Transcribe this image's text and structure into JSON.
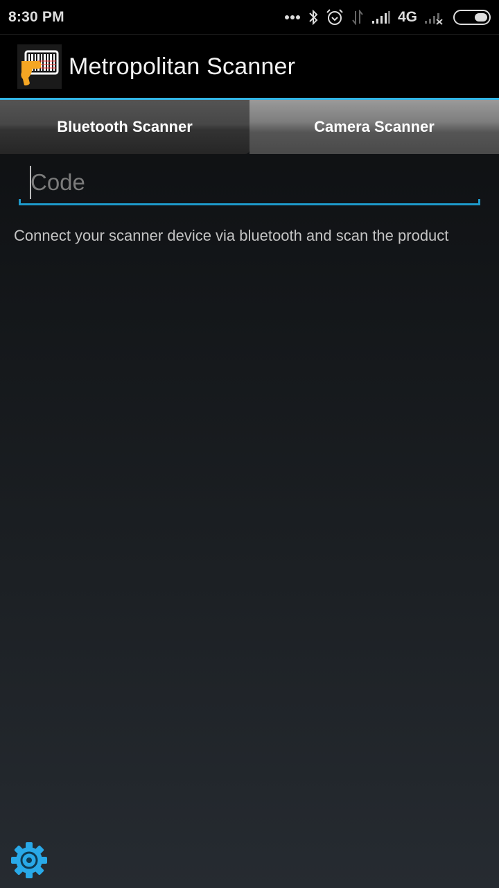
{
  "status_bar": {
    "time": "8:30 PM",
    "icons": [
      "more-dots-icon",
      "bluetooth-icon",
      "alarm-icon",
      "data-transfer-icon",
      "signal-icon",
      "signal-no-sim-icon",
      "battery-icon"
    ],
    "network_type": "4G"
  },
  "action_bar": {
    "app_icon": "barcode-scanner-icon",
    "title": "Metropolitan Scanner"
  },
  "tabs": [
    {
      "label": "Bluetooth Scanner",
      "selected": true
    },
    {
      "label": "Camera Scanner",
      "selected": false
    }
  ],
  "code_field": {
    "value": "",
    "placeholder": "Code"
  },
  "hint": "Connect your scanner device via bluetooth and scan the product",
  "settings": {
    "icon": "gear-icon"
  },
  "colors": {
    "accent": "#33b5e5",
    "input_underline": "#1e9acb",
    "gear": "#29a9e8",
    "app_icon_orange": "#f5a623"
  }
}
